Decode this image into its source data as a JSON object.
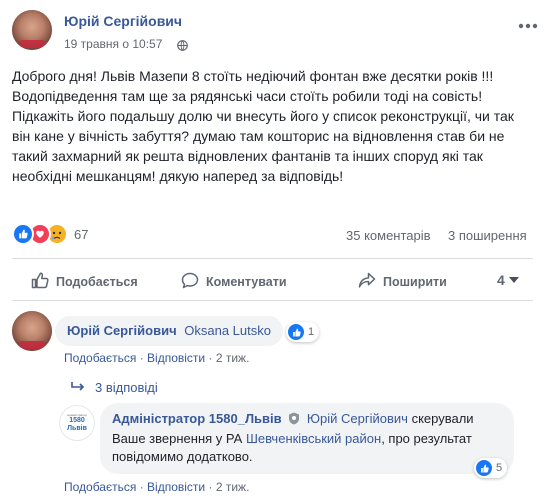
{
  "post": {
    "author": "Юрій Сергійович",
    "timestamp": "19 травня о 10:57",
    "text": "Доброго дня! Львів Мазепи 8 стоїть недіючий фонтан вже десятки років !!! Водопідведення там ще за рядянські часи стоїть робили тоді на совість! Підкажіть його подальшу долю чи внесуть його у список реконструкції, чи так він кане у вічність забуття? думаю там кошторис на відновлення став би не такий захмарний як решта відновлених фантанів та інших споруд які так необхідні мешканцям! дякую наперед за відповідь!",
    "reactions_count": "67",
    "comments_count": "35 коментарів",
    "shares_count": "3 поширення",
    "more_icon": "more-dots-icon"
  },
  "actions": {
    "like": "Подобається",
    "comment": "Коментувати",
    "share": "Поширити",
    "seen_count": "4"
  },
  "comments": [
    {
      "author": "Юрій Сергійович",
      "mention": "Oksana Lutsko",
      "reactions": "1",
      "like_label": "Подобається",
      "reply_label": "Відповісти",
      "time": "2 тиж."
    }
  ],
  "replies_toggle": "3 відповіді",
  "reply": {
    "author": "Адміністратор 1580_Львів",
    "mention": "Юрій Сергійович",
    "text_before": " скерували Ваше звернення у РА ",
    "district": "Шевченківський район",
    "text_after": ", про результат повідомимо додатково.",
    "reactions": "5",
    "like_label": "Подобається",
    "reply_label": "Відповісти",
    "time": "2 тиж.",
    "avatar_text": "1580 Львів",
    "avatar_subtext": "Адміністратор",
    "badge_icon": "verified-shield-icon"
  },
  "colors": {
    "link": "#385898",
    "like_blue": "#1877f2",
    "love_red": "#f33e58",
    "sad_yellow": "#f7b125"
  }
}
